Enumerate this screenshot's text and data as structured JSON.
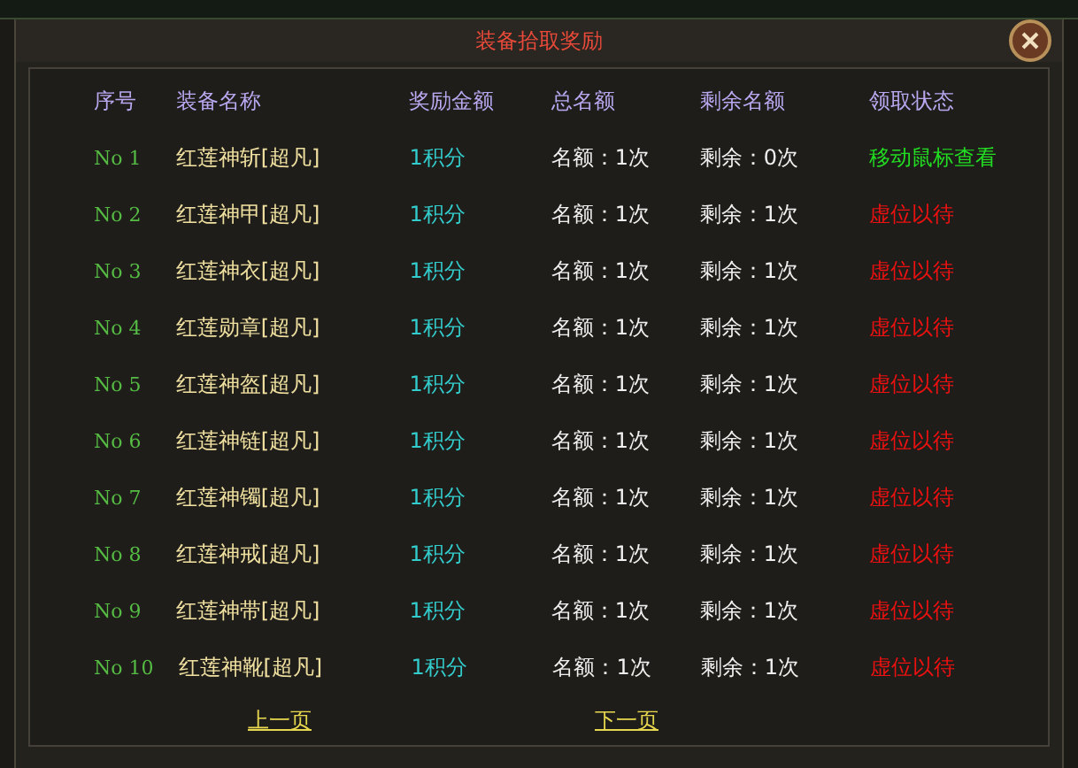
{
  "window": {
    "title": "装备拾取奖励"
  },
  "table": {
    "columns": [
      "序号",
      "装备名称",
      "奖励金额",
      "总名额",
      "剩余名额",
      "领取状态"
    ],
    "rows": [
      {
        "no": "No 1",
        "name": "红莲神斩[超凡]",
        "reward": "1积分",
        "total": "名额：1次",
        "remaining": "剩余：0次",
        "status": "移动鼠标查看",
        "kind": "hover"
      },
      {
        "no": "No 2",
        "name": "红莲神甲[超凡]",
        "reward": "1积分",
        "total": "名额：1次",
        "remaining": "剩余：1次",
        "status": "虚位以待",
        "kind": "vacant"
      },
      {
        "no": "No 3",
        "name": "红莲神衣[超凡]",
        "reward": "1积分",
        "total": "名额：1次",
        "remaining": "剩余：1次",
        "status": "虚位以待",
        "kind": "vacant"
      },
      {
        "no": "No 4",
        "name": "红莲勋章[超凡]",
        "reward": "1积分",
        "total": "名额：1次",
        "remaining": "剩余：1次",
        "status": "虚位以待",
        "kind": "vacant"
      },
      {
        "no": "No 5",
        "name": "红莲神盔[超凡]",
        "reward": "1积分",
        "total": "名额：1次",
        "remaining": "剩余：1次",
        "status": "虚位以待",
        "kind": "vacant"
      },
      {
        "no": "No 6",
        "name": "红莲神链[超凡]",
        "reward": "1积分",
        "total": "名额：1次",
        "remaining": "剩余：1次",
        "status": "虚位以待",
        "kind": "vacant"
      },
      {
        "no": "No 7",
        "name": "红莲神镯[超凡]",
        "reward": "1积分",
        "total": "名额：1次",
        "remaining": "剩余：1次",
        "status": "虚位以待",
        "kind": "vacant"
      },
      {
        "no": "No 8",
        "name": "红莲神戒[超凡]",
        "reward": "1积分",
        "total": "名额：1次",
        "remaining": "剩余：1次",
        "status": "虚位以待",
        "kind": "vacant"
      },
      {
        "no": "No 9",
        "name": "红莲神带[超凡]",
        "reward": "1积分",
        "total": "名额：1次",
        "remaining": "剩余：1次",
        "status": "虚位以待",
        "kind": "vacant"
      },
      {
        "no": "No 10",
        "name": "红莲神靴[超凡]",
        "reward": "1积分",
        "total": "名额：1次",
        "remaining": "剩余：1次",
        "status": "虚位以待",
        "kind": "vacant"
      }
    ]
  },
  "pagination": {
    "previous": "上一页",
    "next": "下一页"
  }
}
